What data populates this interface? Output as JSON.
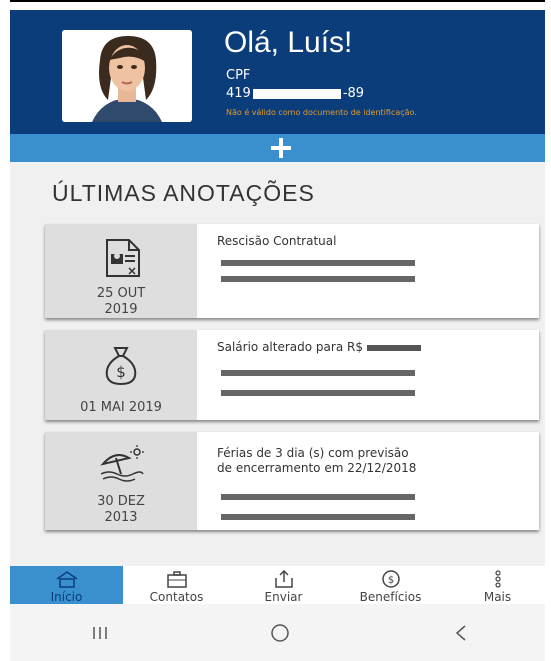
{
  "profile": {
    "greeting": "Olá, Luís!",
    "cpf_label": "CPF",
    "cpf_prefix": "419",
    "cpf_suffix": "-89",
    "cpf_note": "Não é válido como documento de identificação."
  },
  "section": {
    "title": "ÚLTIMAS ANOTAÇÕES"
  },
  "cards": [
    {
      "icon": "contract-document-icon",
      "date_line1": "25 OUT",
      "date_line2": "2019",
      "title": "Rescisão Contratual"
    },
    {
      "icon": "money-bag-icon",
      "date_line1": "01 MAI 2019",
      "date_line2": "",
      "title": "Salário alterado para R$"
    },
    {
      "icon": "beach-umbrella-icon",
      "date_line1": "30 DEZ",
      "date_line2": "2013",
      "title": "Férias de 3 dia (s) com previsão",
      "title_line2": "de encerramento em 22/12/2018"
    }
  ],
  "nav": {
    "items": [
      {
        "label": "Início",
        "icon": "house-icon"
      },
      {
        "label": "Contatos",
        "icon": "briefcase-icon"
      },
      {
        "label": "Enviar",
        "icon": "upload-icon"
      },
      {
        "label": "Benefícios",
        "icon": "dollar-circle-icon"
      },
      {
        "label": "Mais",
        "icon": "more-dots-icon"
      }
    ]
  },
  "colors": {
    "header": "#0b3d7a",
    "accent": "#3a8fcf",
    "warning": "#e29a2b"
  }
}
